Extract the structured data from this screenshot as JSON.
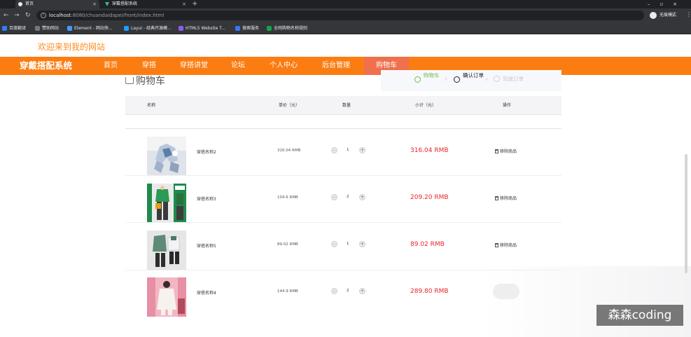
{
  "browser": {
    "tabs": [
      {
        "title": "首页"
      },
      {
        "title": "穿戴搭配系统"
      }
    ],
    "url_host": "localhost",
    "url_rest": ":8080/chuandaidapei/front/index.html",
    "incognito_label": "无痕模式",
    "bookmarks": [
      {
        "label": "百度翻译",
        "color": "#2f7bff"
      },
      {
        "label": "赞助网站",
        "color": "#444444"
      },
      {
        "label": "Element - 网站快...",
        "color": "#409eff"
      },
      {
        "label": "Layui - 经典开源模...",
        "color": "#1e9fff"
      },
      {
        "label": "HTML5 Website T...",
        "color": "#8a5cf5"
      },
      {
        "label": "搜索服务",
        "color": "#3478f6"
      },
      {
        "label": "全网购物名称规则",
        "color": "#17a34a"
      }
    ]
  },
  "site": {
    "welcome": "欢迎来到我的网站",
    "title": "穿戴搭配系统",
    "nav": [
      "首页",
      "穿搭",
      "穿搭讲堂",
      "论坛",
      "个人中心",
      "后台管理",
      "购物车"
    ],
    "active_nav": "购物车",
    "accent_color": "#fb7d12"
  },
  "cart": {
    "heading": "购物车",
    "steps": [
      {
        "label": "购物车",
        "state": "done"
      },
      {
        "label": "确认订单",
        "state": "current"
      },
      {
        "label": "完成订单",
        "state": "pending"
      }
    ],
    "columns": [
      "名称",
      "单价（元）",
      "数量",
      "小计（元）",
      "操作"
    ],
    "remove_label": "移除商品",
    "items": [
      {
        "name": "穿搭名称2",
        "price": "316.04 RMB",
        "qty": "1",
        "subtotal": "316.04 RMB",
        "thumb": "blue-white outfit"
      },
      {
        "name": "穿搭名称3",
        "price": "104.6 RMB",
        "qty": "2",
        "subtotal": "209.20 RMB",
        "thumb": "green look outfit"
      },
      {
        "name": "穿搭名称5",
        "price": "89.02 RMB",
        "qty": "1",
        "subtotal": "89.02 RMB",
        "thumb": "green jacket outfit"
      },
      {
        "name": "穿搭名称4",
        "price": "144.9 RMB",
        "qty": "2",
        "subtotal": "289.80 RMB",
        "thumb": "pink coat outfit"
      }
    ]
  },
  "overlay": {
    "watermark": "森森coding"
  }
}
